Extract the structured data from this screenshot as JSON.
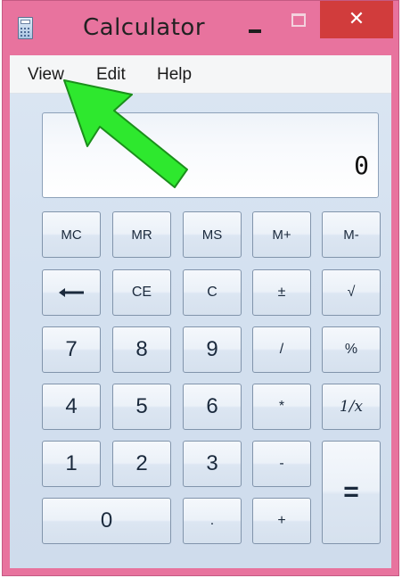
{
  "window": {
    "title": "Calculator",
    "close_glyph": "✕"
  },
  "menu": {
    "items": [
      "View",
      "Edit",
      "Help"
    ]
  },
  "display": {
    "value": "0"
  },
  "keys": {
    "mc": "MC",
    "mr": "MR",
    "ms": "MS",
    "mplus": "M+",
    "mminus": "M-",
    "backspace_icon": "left-arrow-icon",
    "ce": "CE",
    "c": "C",
    "plusminus": "±",
    "sqrt": "√",
    "seven": "7",
    "eight": "8",
    "nine": "9",
    "divide": "/",
    "percent": "%",
    "four": "4",
    "five": "5",
    "six": "6",
    "multiply": "*",
    "reciprocal": "1/x",
    "one": "1",
    "two": "2",
    "three": "3",
    "minus": "-",
    "equals": "=",
    "zero": "0",
    "decimal": ".",
    "plus": "+"
  },
  "annotation": {
    "pointer_icon": "green-arrow-icon",
    "color": "#2ee82e"
  },
  "colors": {
    "window_frame": "#e8739e",
    "close_button": "#d13c3c"
  }
}
